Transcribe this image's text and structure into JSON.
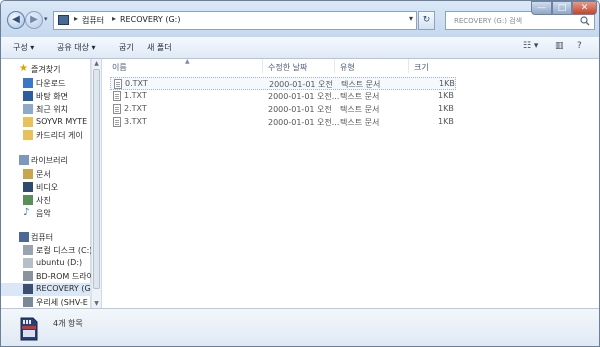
{
  "window": {
    "controls": {
      "minimize": "—",
      "maximize": "□",
      "close": "✕"
    }
  },
  "address": {
    "root_label": "컴퓨터",
    "current_label": "RECOVERY (G:)",
    "separator": "▸"
  },
  "search": {
    "placeholder": "RECOVERY (G:) 검색"
  },
  "toolbar": {
    "organize": "구성 ▾",
    "share": "공유 대상 ▾",
    "burn": "굽기",
    "new_folder": "새 폴더",
    "view_icon": "view-options-icon",
    "preview_icon": "preview-pane-icon",
    "help_icon": "help-icon"
  },
  "navpane": {
    "favorites_header": "즐겨찾기",
    "favorites": [
      {
        "label": "다운로드",
        "icon": "download-folder-icon"
      },
      {
        "label": "바탕 화면",
        "icon": "desktop-icon"
      },
      {
        "label": "최근 위치",
        "icon": "recent-places-icon"
      },
      {
        "label": "SOYVR MYTE",
        "icon": "folder-icon"
      },
      {
        "label": "카드리더 게이",
        "icon": "folder-icon"
      }
    ],
    "libraries_header": "라이브러리",
    "libraries": [
      {
        "label": "문서",
        "icon": "documents-library-icon"
      },
      {
        "label": "비디오",
        "icon": "videos-library-icon"
      },
      {
        "label": "사진",
        "icon": "pictures-library-icon"
      },
      {
        "label": "음악",
        "icon": "music-library-icon"
      }
    ],
    "computer_header": "컴퓨터",
    "drives": [
      {
        "label": "로컬 디스크 (C:)",
        "icon": "local-disk-icon"
      },
      {
        "label": "ubuntu (D:)",
        "icon": "drive-icon"
      },
      {
        "label": "BD-ROM 드라이",
        "icon": "optical-drive-icon"
      },
      {
        "label": "RECOVERY (G:)",
        "icon": "sd-card-drive-icon"
      },
      {
        "label": "우리세 (SHV-E",
        "icon": "phone-device-icon"
      }
    ]
  },
  "columns": {
    "name": "이름",
    "modified": "수정한 날짜",
    "type": "유형",
    "size": "크기"
  },
  "files": [
    {
      "name": "0.TXT",
      "modified": "2000-01-01 오전",
      "type": "텍스트 문서",
      "size": "1KB"
    },
    {
      "name": "1.TXT",
      "modified": "2000-01-01 오전...",
      "type": "텍스트 문서",
      "size": "1KB"
    },
    {
      "name": "2.TXT",
      "modified": "2000-01-01 오전",
      "type": "텍스트 문서",
      "size": "1KB"
    },
    {
      "name": "3.TXT",
      "modified": "2000-01-01 오전...",
      "type": "텍스트 문서",
      "size": "1KB"
    }
  ],
  "details": {
    "item_count": "4개 항목"
  },
  "colors": {
    "accent": "#c9dcef",
    "selection": "#d9e7f7",
    "close_button": "#c4442b"
  }
}
